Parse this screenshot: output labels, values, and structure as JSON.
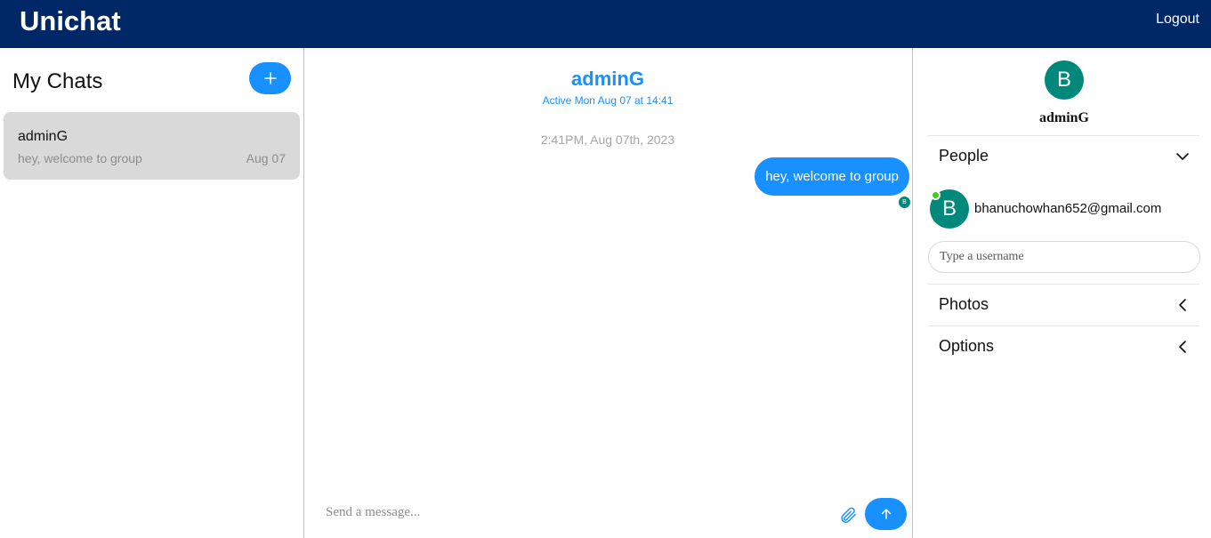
{
  "header": {
    "brand": "Unichat",
    "logout_label": "Logout"
  },
  "colors": {
    "nav": "#002766",
    "accent": "#1890ff",
    "avatar": "#00897b",
    "online": "#52c41a"
  },
  "sidebar": {
    "title": "My Chats",
    "new_chat_icon": "plus-icon",
    "chats": [
      {
        "title": "adminG",
        "last_message": "hey, welcome to group",
        "date": "Aug 07"
      }
    ]
  },
  "conversation": {
    "title": "adminG",
    "active_text": "Active Mon Aug 07 at 14:41",
    "timestamp": "2:41PM, Aug 07th, 2023",
    "messages": [
      {
        "text": "hey, welcome to group",
        "read_by_initial": "B"
      }
    ],
    "composer": {
      "placeholder": "Send a message...",
      "attach_icon": "paperclip-icon",
      "send_icon": "arrow-up-icon"
    }
  },
  "settings": {
    "avatar_initial": "B",
    "group_name": "adminG",
    "sections": {
      "people": "People",
      "photos": "Photos",
      "options": "Options"
    },
    "people": [
      {
        "initial": "B",
        "email": "bhanuchowhan652@gmail.com",
        "online": true
      }
    ],
    "username_placeholder": "Type a username"
  }
}
